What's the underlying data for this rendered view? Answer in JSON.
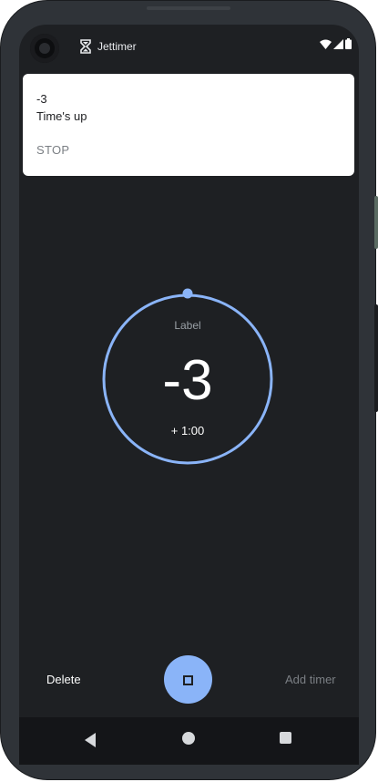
{
  "status_bar": {
    "app_name": "Jettimer",
    "app_icon": "hourglass-icon",
    "icons": [
      "wifi-icon",
      "signal-icon",
      "battery-icon"
    ]
  },
  "notification": {
    "title": "-3",
    "text": "Time's up",
    "action": "STOP"
  },
  "timer": {
    "label": "Label",
    "value": "-3",
    "add_minute": "+ 1:00",
    "ring_color": "#8ab4f8"
  },
  "bottom_bar": {
    "delete_label": "Delete",
    "stop_icon": "stop-icon",
    "add_timer_label": "Add timer",
    "fab_color": "#8ab4f8"
  },
  "nav_bar": {
    "icons": [
      "back-icon",
      "home-icon",
      "recents-icon"
    ]
  }
}
